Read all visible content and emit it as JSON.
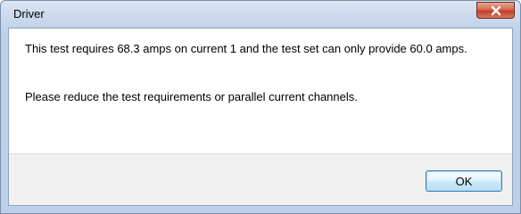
{
  "window": {
    "title": "Driver"
  },
  "dialog": {
    "message_line1": "This test requires 68.3 amps on current 1 and the test set can only provide 60.0 amps.",
    "message_line2": "Please reduce the test requirements or parallel current channels.",
    "ok_label": "OK"
  },
  "icons": {
    "close": "close-icon"
  },
  "colors": {
    "titlebar": "#c9d8ec",
    "close_button": "#c2412b",
    "ok_button_border": "#3c7fb1",
    "footer": "#f0f0f0"
  }
}
